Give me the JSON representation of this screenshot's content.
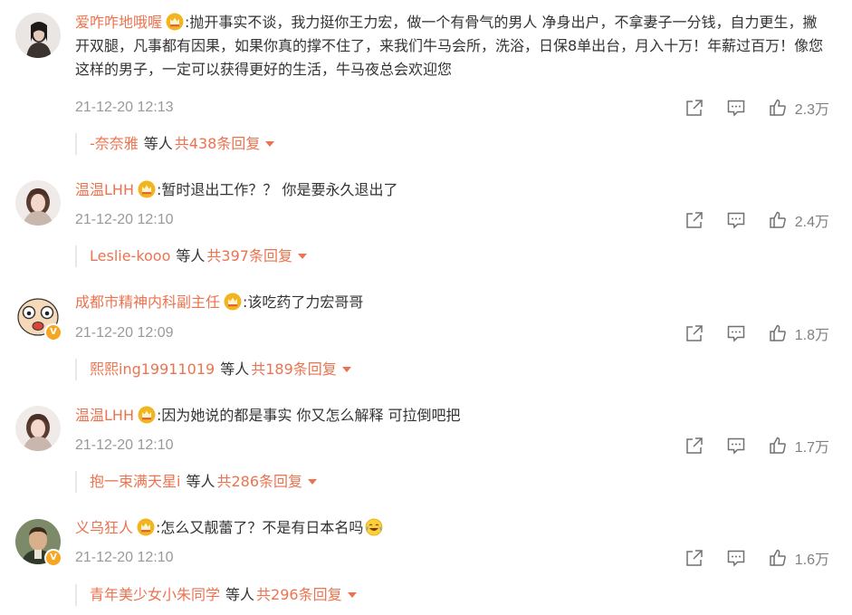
{
  "comments": [
    {
      "username": "爱咋咋地哦喔",
      "text": ":抛开事实不谈，我力挺你王力宏，做一个有骨气的男人 净身出户，不拿妻子一分钱，自力更生，撇开双腿，凡事都有因果，如果你真的撑不住了，来我们牛马会所，洗浴，日保8单出台，月入十万！年薪过百万！像您这样的男子，一定可以获得更好的生活，牛马夜总会欢迎您",
      "time": "21-12-20 12:13",
      "likes": "2.3万",
      "reply_user": "-奈奈雅",
      "reply_etc": "等人",
      "reply_total": "共438条回复"
    },
    {
      "username": "温温LHH",
      "text": ":暂时退出工作？？ 你是要永久退出了",
      "time": "21-12-20 12:10",
      "likes": "2.4万",
      "reply_user": "Leslie-kooo",
      "reply_etc": "等人",
      "reply_total": "共397条回复"
    },
    {
      "username": "成都市精神内科副主任",
      "text": ":该吃药了力宏哥哥",
      "time": "21-12-20 12:09",
      "likes": "1.8万",
      "reply_user": "熙熙ing19911019",
      "reply_etc": "等人",
      "reply_total": "共189条回复"
    },
    {
      "username": "温温LHH",
      "text": ":因为她说的都是事实 你又怎么解释 可拉倒吧把",
      "time": "21-12-20 12:10",
      "likes": "1.7万",
      "reply_user": "抱一束满天星i",
      "reply_etc": "等人",
      "reply_total": "共286条回复"
    },
    {
      "username": "义乌狂人",
      "text": ":怎么又靓蕾了？不是有日本名吗",
      "time": "21-12-20 12:10",
      "likes": "1.6万",
      "reply_user": "青年美少女小朱同学",
      "reply_etc": "等人",
      "reply_total": "共296条回复"
    }
  ],
  "icons": {
    "crown": "vip-crown-icon",
    "share": "share-icon",
    "comment": "comment-icon",
    "like": "like-thumb-icon",
    "laugh_cry": "laugh-cry-emoji-icon",
    "verified": "verified-v-badge"
  },
  "badge_letter": "V",
  "colors": {
    "username": "#eb7350",
    "text": "#333333",
    "meta": "#999999",
    "verified": "#f5a623"
  }
}
